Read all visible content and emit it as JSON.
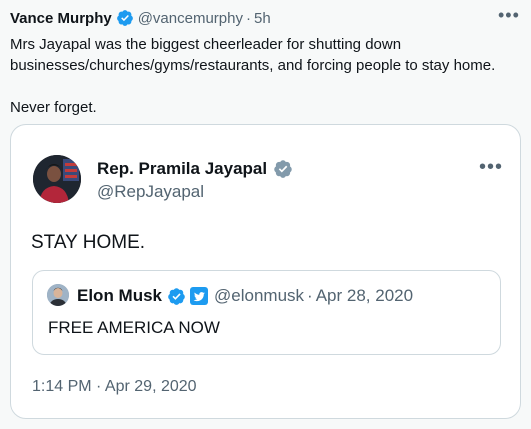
{
  "outer_tweet": {
    "display_name": "Vance Murphy",
    "handle": "@vancemurphy",
    "separator": "·",
    "time": "5h",
    "text": "Mrs Jayapal was the biggest cheerleader for shutting down businesses/churches/gyms/restaurants, and forcing people to stay home.\n\nNever forget.",
    "more_icon": "more-horizontal-icon",
    "verified_icon": "verified-badge-icon"
  },
  "quoted_tweet": {
    "display_name": "Rep. Pramila Jayapal",
    "handle": "@RepJayapal",
    "text": "STAY HOME.",
    "timestamp": "1:14 PM · Apr 29, 2020",
    "verified_color": "#829aab",
    "more_icon": "more-horizontal-icon"
  },
  "nested_quote": {
    "display_name": "Elon Musk",
    "handle": "@elonmusk",
    "separator": "·",
    "date": "Apr 28, 2020",
    "text": "FREE AMERICA NOW",
    "verified_color": "#1d9bf0",
    "secondary_badge": "twitter-bird-icon"
  },
  "colors": {
    "background": "#f7f9f9",
    "card": "#ffffff",
    "border": "#cfd9de",
    "muted_text": "#536471",
    "accent_blue": "#1d9bf0"
  }
}
